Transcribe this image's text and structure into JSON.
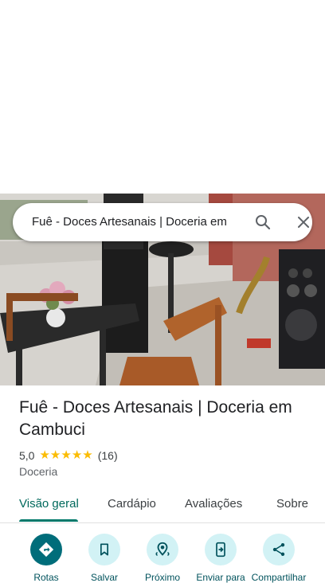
{
  "search": {
    "query": "Fuê - Doces Artesanais | Doceria em"
  },
  "place": {
    "title": "Fuê - Doces Artesanais | Doceria em Cambuci",
    "rating": "5,0",
    "stars": 5,
    "reviews": "(16)",
    "category": "Doceria"
  },
  "tabs": [
    "Visão geral",
    "Cardápio",
    "Avaliações",
    "Sobre"
  ],
  "actions": [
    {
      "label": "Rotas",
      "icon": "directions-icon"
    },
    {
      "label": "Salvar",
      "icon": "bookmark-icon"
    },
    {
      "label": "Próximo",
      "icon": "nearby-icon"
    },
    {
      "label": "Enviar para",
      "icon": "send-to-phone-icon"
    },
    {
      "label": "Compartilhar",
      "icon": "share-icon"
    }
  ],
  "colors": {
    "accent": "#00796b",
    "primary_button": "#006d7a",
    "star": "#fbbc04"
  }
}
